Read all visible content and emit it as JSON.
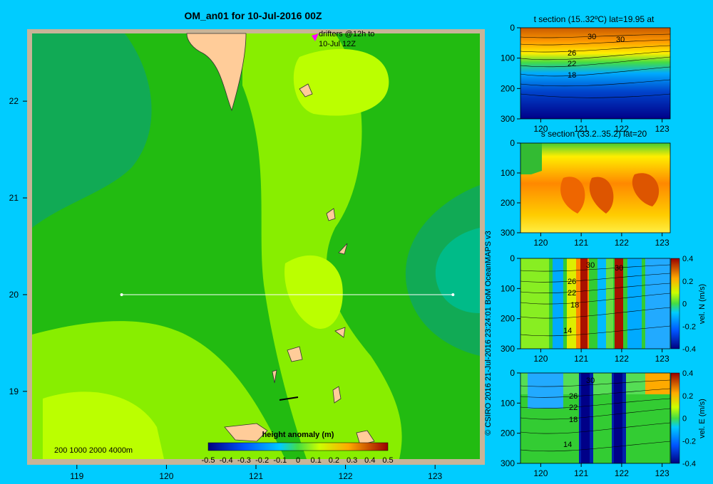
{
  "chart_data": [
    {
      "type": "heatmap",
      "title": "OM_an01 for 10-Jul-2016 00Z",
      "x_ticks": [
        "119",
        "120",
        "121",
        "122",
        "123"
      ],
      "y_ticks": [
        "22",
        "21",
        "20",
        "19"
      ],
      "xlim": [
        118.5,
        123.5
      ],
      "ylim": [
        18.3,
        22.7
      ],
      "section_line": {
        "lon": [
          119.5,
          123.2
        ],
        "lat": 20
      },
      "drifter_note": [
        "drifters @12h to",
        "10-Jul 12Z"
      ],
      "depth_scale_label": "200  1000  2000  4000m",
      "colorbar": {
        "label": "height anomaly  (m)",
        "range": [
          -0.5,
          0.5
        ],
        "ticks": [
          "-0.5",
          "-0.4",
          "-0.3",
          "-0.2",
          "-0.1",
          "0",
          "0.1",
          "0.2",
          "0.3",
          "0.4",
          "0.5"
        ]
      }
    },
    {
      "type": "heatmap",
      "title": "t section (15..32ºC) lat=19.95 at",
      "x_ticks": [
        "120",
        "121",
        "122",
        "123"
      ],
      "y_ticks": [
        "0",
        "100",
        "200",
        "300"
      ],
      "xlim": [
        119.5,
        123.2
      ],
      "ylim": [
        300,
        0
      ],
      "contour_labels": [
        "30",
        "30",
        "26",
        "22",
        "18"
      ]
    },
    {
      "type": "heatmap",
      "title": "s section (33.2..35.2) lat=20",
      "x_ticks": [
        "120",
        "121",
        "122",
        "123"
      ],
      "y_ticks": [
        "0",
        "100",
        "200",
        "300"
      ],
      "xlim": [
        119.5,
        123.2
      ],
      "ylim": [
        300,
        0
      ]
    },
    {
      "type": "heatmap",
      "x_ticks": [
        "120",
        "121",
        "122",
        "123"
      ],
      "y_ticks": [
        "0",
        "100",
        "200",
        "300"
      ],
      "xlim": [
        119.5,
        123.2
      ],
      "ylim": [
        300,
        0
      ],
      "contour_labels": [
        "30",
        "30",
        "26",
        "22",
        "18",
        "14"
      ],
      "colorbar": {
        "label": "vel. N  (m/s)",
        "range": [
          -0.4,
          0.4
        ],
        "ticks": [
          "0.4",
          "0.2",
          "0",
          "-0.2",
          "-0.4"
        ]
      }
    },
    {
      "type": "heatmap",
      "x_ticks": [
        "120",
        "121",
        "122",
        "123"
      ],
      "y_ticks": [
        "0",
        "100",
        "200",
        "300"
      ],
      "xlim": [
        119.5,
        123.2
      ],
      "ylim": [
        300,
        0
      ],
      "contour_labels": [
        "30",
        "26",
        "22",
        "18",
        "14"
      ],
      "colorbar": {
        "label": "vel. E  (m/s)",
        "range": [
          -0.4,
          0.4
        ],
        "ticks": [
          "0.4",
          "0.2",
          "0",
          "-0.2",
          "-0.4"
        ]
      }
    }
  ],
  "credit": "© CSIRO 2016   21-Jul-2016 23:24:01 BoM OceanMAPS v3"
}
